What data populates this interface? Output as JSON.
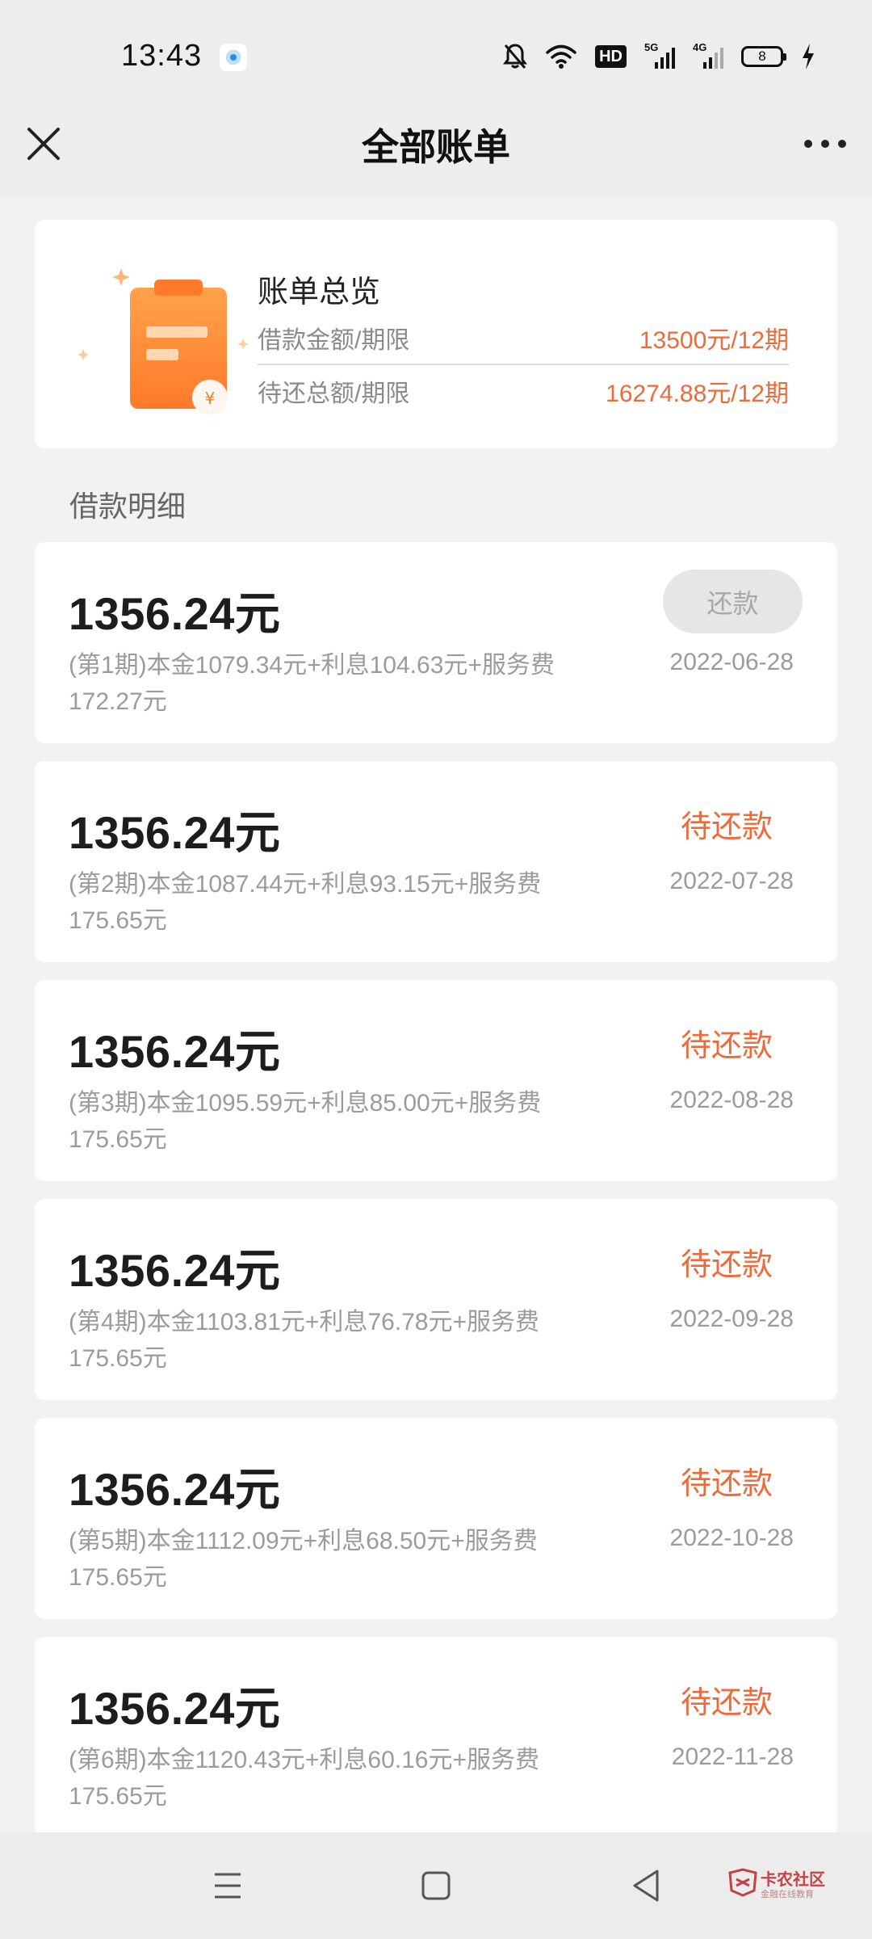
{
  "status_bar": {
    "time": "13:43",
    "icons": [
      "browser-app-icon",
      "mute-bell-icon",
      "wifi-icon",
      "hd-icon",
      "signal-5g-icon",
      "signal-4g-icon",
      "battery-icon",
      "charging-icon"
    ],
    "hd_label": "HD",
    "net1_label": "5G",
    "net2_label": "4G",
    "battery_level": "8"
  },
  "nav": {
    "title": "全部账单"
  },
  "summary": {
    "title": "账单总览",
    "loan_label": "借款金额/期限",
    "loan_value": "13500元/12期",
    "repay_label": "待还总额/期限",
    "repay_value": "16274.88元/12期"
  },
  "section_title": "借款明细",
  "bills": [
    {
      "amount": "1356.24元",
      "detail": "(第1期)本金1079.34元+利息104.63元+服务费172.27元",
      "date": "2022-06-28",
      "action_label": "还款",
      "action_type": "button"
    },
    {
      "amount": "1356.24元",
      "detail": "(第2期)本金1087.44元+利息93.15元+服务费175.65元",
      "date": "2022-07-28",
      "action_label": "待还款",
      "action_type": "status"
    },
    {
      "amount": "1356.24元",
      "detail": "(第3期)本金1095.59元+利息85.00元+服务费175.65元",
      "date": "2022-08-28",
      "action_label": "待还款",
      "action_type": "status"
    },
    {
      "amount": "1356.24元",
      "detail": "(第4期)本金1103.81元+利息76.78元+服务费175.65元",
      "date": "2022-09-28",
      "action_label": "待还款",
      "action_type": "status"
    },
    {
      "amount": "1356.24元",
      "detail": "(第5期)本金1112.09元+利息68.50元+服务费175.65元",
      "date": "2022-10-28",
      "action_label": "待还款",
      "action_type": "status"
    },
    {
      "amount": "1356.24元",
      "detail": "(第6期)本金1120.43元+利息60.16元+服务费175.65元",
      "date": "2022-11-28",
      "action_label": "待还款",
      "action_type": "status"
    }
  ],
  "system_nav": {
    "buttons": [
      "menu-icon",
      "home-icon",
      "back-icon"
    ]
  },
  "watermark": {
    "title": "卡农社区",
    "subtitle": "金融在线教育"
  },
  "colors": {
    "accent": "#ee6a3a",
    "background": "#f2f2f2",
    "card": "#ffffff",
    "muted_text": "#9b9b9b"
  }
}
